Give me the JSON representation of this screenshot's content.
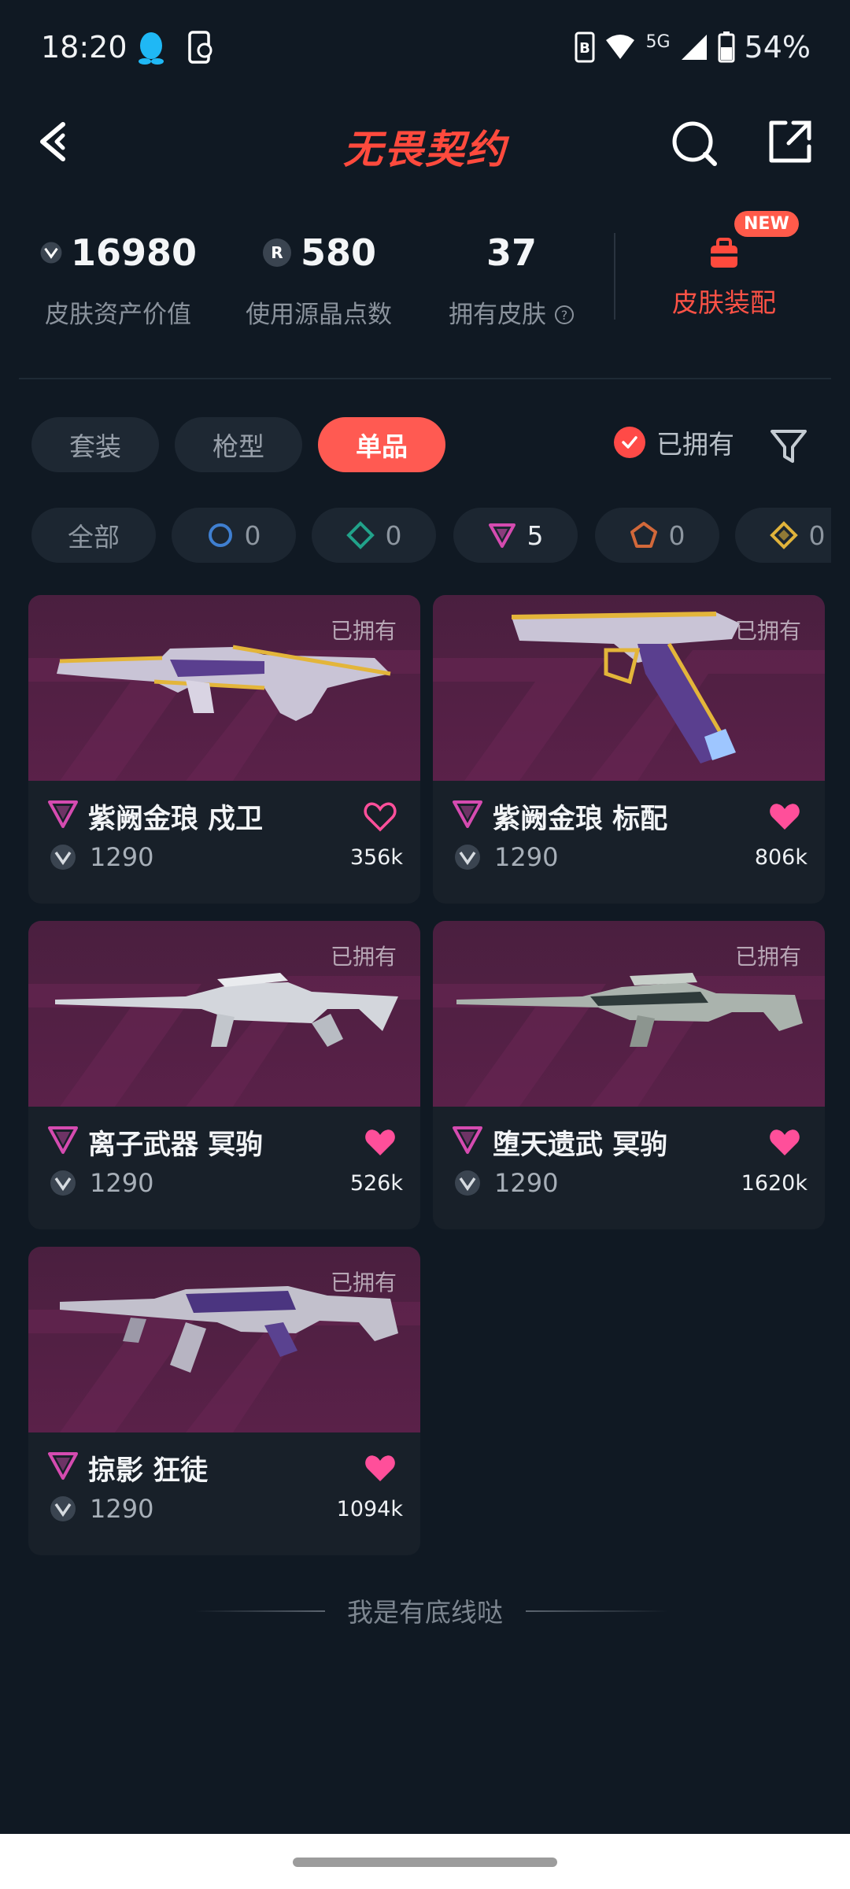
{
  "status_bar": {
    "time": "18:20",
    "network": "5G",
    "battery": "54%"
  },
  "header": {
    "title": "无畏契约"
  },
  "stats": [
    {
      "value": "16980",
      "label": "皮肤资产价值",
      "icon": "vp-icon"
    },
    {
      "value": "580",
      "label": "使用源晶点数",
      "icon": "radianite-icon"
    },
    {
      "value": "37",
      "label": "拥有皮肤",
      "icon": "help-icon"
    }
  ],
  "outfit": {
    "label": "皮肤装配",
    "badge": "NEW"
  },
  "tabs": [
    "套装",
    "枪型",
    "单品"
  ],
  "active_tab": "单品",
  "owned_filter": {
    "label": "已拥有",
    "checked": true
  },
  "rarity_chips": [
    {
      "label": "全部"
    },
    {
      "tier": "select",
      "count": "0",
      "color": "#3f7fd0"
    },
    {
      "tier": "deluxe",
      "count": "0",
      "color": "#21a28a"
    },
    {
      "tier": "premium",
      "count": "5",
      "color": "#d54bb0"
    },
    {
      "tier": "exclusive",
      "count": "0",
      "color": "#d2683a"
    },
    {
      "tier": "ultra",
      "count": "0",
      "color": "#e0b33b"
    }
  ],
  "cards": [
    {
      "name": "紫阙金琅 戍卫",
      "price": "1290",
      "likes": "356k",
      "owned": "已拥有",
      "liked": false
    },
    {
      "name": "紫阙金琅 标配",
      "price": "1290",
      "likes": "806k",
      "owned": "已拥有",
      "liked": true
    },
    {
      "name": "离子武器 冥驹",
      "price": "1290",
      "likes": "526k",
      "owned": "已拥有",
      "liked": true
    },
    {
      "name": "堕天遗武 冥驹",
      "price": "1290",
      "likes": "1620k",
      "owned": "已拥有",
      "liked": true
    },
    {
      "name": "掠影 狂徒",
      "price": "1290",
      "likes": "1094k",
      "owned": "已拥有",
      "liked": true
    }
  ],
  "footer": {
    "end_text": "我是有底线哒"
  },
  "colors": {
    "accent": "#ff5a52",
    "background": "#101923",
    "card": "#182029",
    "premium": "#d54bb0",
    "heart": "#ff4f9a"
  }
}
